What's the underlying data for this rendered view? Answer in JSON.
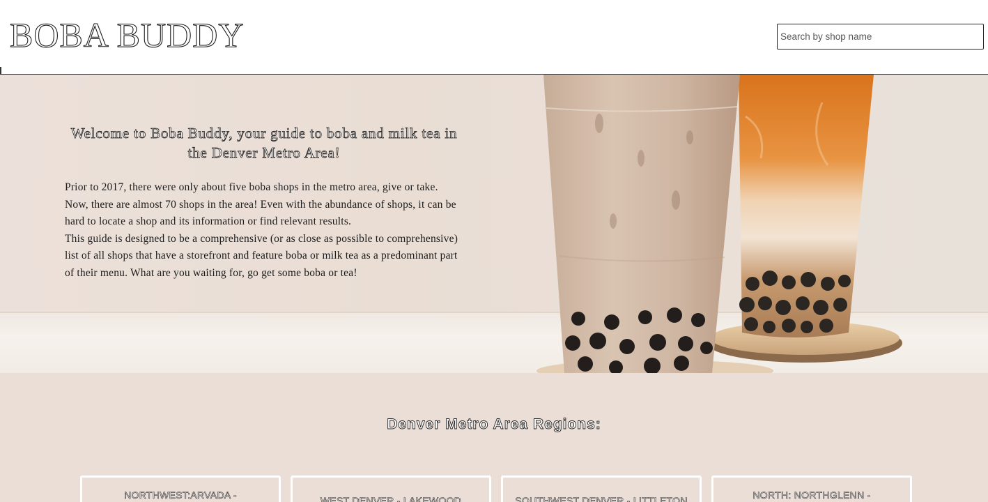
{
  "header": {
    "logo": "BOBA BUDDY",
    "search_placeholder": "Search by shop name"
  },
  "hero": {
    "title": "Welcome to Boba Buddy, your guide to boba and milk tea in the Denver Metro Area!",
    "paragraphs": [
      "Prior to 2017, there were only about five boba shops in the metro area, give or take. Now, there are almost 70 shops in the area! Even with the abundance of shops, it can be hard to locate a shop and its information or find relevant results.",
      "This guide is designed to be a comprehensive (or as close as possible to comprehensive) list of all shops that have a storefront and feature boba or milk tea as a predominant part of their menu. What are you waiting for, go get some boba or tea!"
    ],
    "image": "boba-milk-tea-cups-photo"
  },
  "regions": {
    "title": "Denver Metro Area Regions:",
    "cards": [
      {
        "label": "NORTHWEST:ARVADA -"
      },
      {
        "label": "WEST DENVER - LAKEWOOD"
      },
      {
        "label": "SOUTHWEST DENVER - LITTLETON"
      },
      {
        "label": "NORTH: NORTHGLENN -"
      }
    ]
  },
  "colors": {
    "hero_background": "#e9ddd4",
    "regions_background": "#ebded7",
    "card_border": "#ffffff",
    "text_outline": "#222222"
  }
}
